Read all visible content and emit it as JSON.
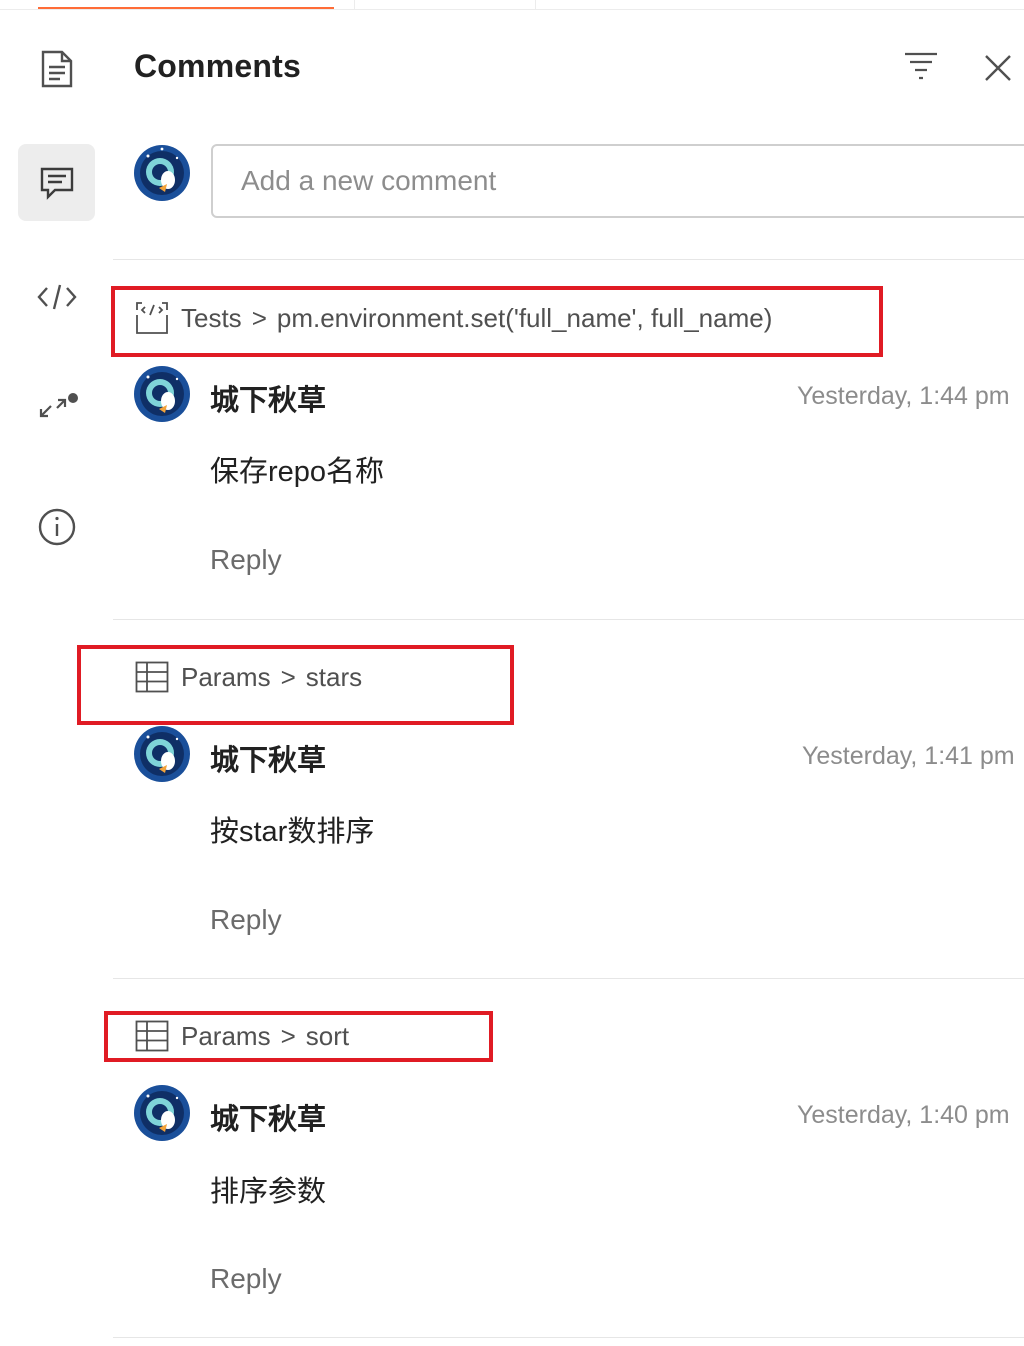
{
  "panel": {
    "title": "Comments",
    "input_placeholder": "Add a new comment"
  },
  "rail": [
    {
      "icon": "document-icon",
      "active": false
    },
    {
      "icon": "comment-icon",
      "active": true
    },
    {
      "icon": "code-icon",
      "active": false
    },
    {
      "icon": "resize-icon",
      "active": false
    },
    {
      "icon": "info-icon",
      "active": false
    }
  ],
  "comments": [
    {
      "context": {
        "icon": "code-snippet-icon",
        "section": "Tests",
        "separator": ">",
        "target": "pm.environment.set('full_name', full_name)"
      },
      "author": "城下秋草",
      "time": "Yesterday, 1:44 pm",
      "body": "保存repo名称",
      "reply": "Reply"
    },
    {
      "context": {
        "icon": "table-icon",
        "section": "Params",
        "separator": ">",
        "target": "stars"
      },
      "author": "城下秋草",
      "time": "Yesterday, 1:41 pm",
      "body": "按star数排序",
      "reply": "Reply"
    },
    {
      "context": {
        "icon": "table-icon",
        "section": "Params",
        "separator": ">",
        "target": "sort"
      },
      "author": "城下秋草",
      "time": "Yesterday, 1:40 pm",
      "body": "排序参数",
      "reply": "Reply"
    }
  ],
  "colors": {
    "accent": "#ff6c37",
    "highlight": "#e01b24",
    "avatar_bg": "#1a4f9a",
    "avatar_face": "#7fd4d8"
  }
}
